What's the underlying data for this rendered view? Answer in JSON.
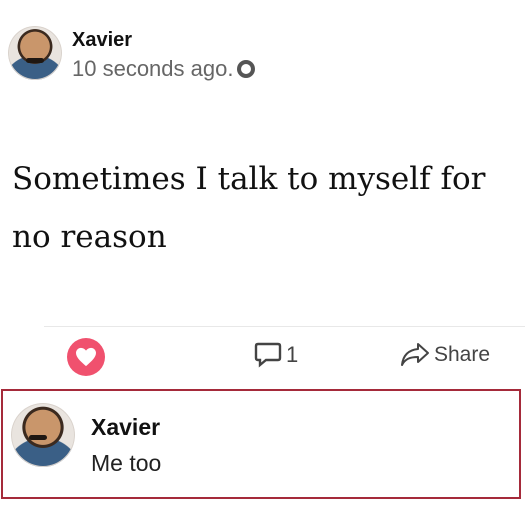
{
  "post": {
    "author": "Xavier",
    "timestamp": "10 seconds ago.",
    "privacy_icon": "globe-icon",
    "text_line1": "Sometimes I talk to myself for",
    "text_line2": "no reason"
  },
  "actions": {
    "like_icon": "heart-icon",
    "comment_count": "1",
    "share_label": "Share"
  },
  "reply": {
    "author": "Xavier",
    "text": "Me too"
  },
  "colors": {
    "like": "#f0516e",
    "highlight_border": "#a52a3a"
  }
}
